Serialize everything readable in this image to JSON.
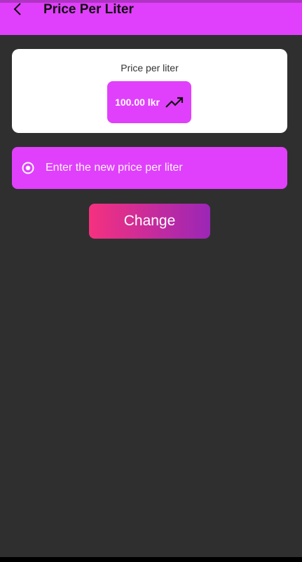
{
  "app_bar": {
    "title": "Price Per Liter",
    "back_icon": "chevron-left-icon",
    "color": "#e040fb"
  },
  "price_card": {
    "label": "Price per liter",
    "value": "100.00 lkr",
    "icon": "trending-up-icon"
  },
  "input": {
    "placeholder": "Enter the new price per liter",
    "value": "",
    "icon": "radio-button-icon"
  },
  "change_button": {
    "label": "Change",
    "gradient_start": "#f5317f",
    "gradient_end": "#9b26b6"
  },
  "colors": {
    "background": "#2f2f2f",
    "accent": "#e040fb",
    "card": "#ffffff"
  }
}
